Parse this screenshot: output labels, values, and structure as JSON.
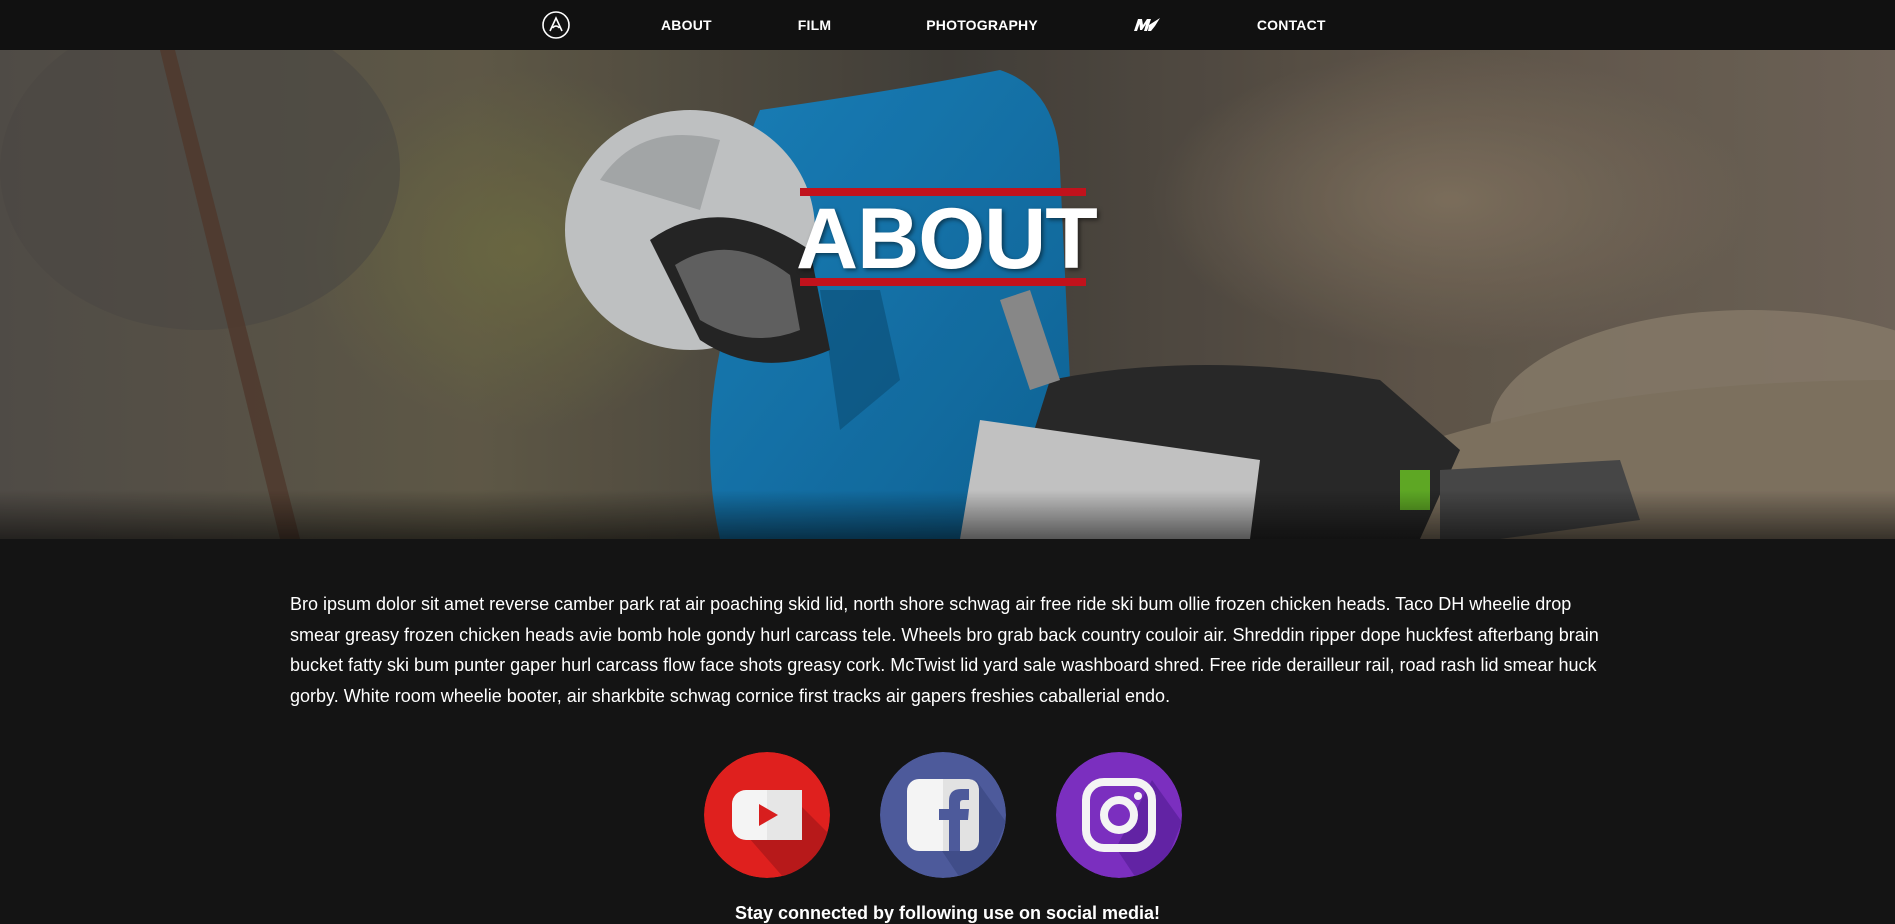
{
  "nav": {
    "items": [
      {
        "label": "ABOUT"
      },
      {
        "label": "FILM"
      },
      {
        "label": "PHOTOGRAPHY"
      },
      {
        "label": "CONTACT"
      }
    ]
  },
  "hero": {
    "title": "ABOUT",
    "accent_color": "#c1121c"
  },
  "about": {
    "text": "Bro ipsum dolor sit amet reverse camber park rat air poaching skid lid, north shore schwag air free ride ski bum ollie frozen chicken heads. Taco DH wheelie drop smear greasy frozen chicken heads avie bomb hole gondy hurl carcass tele. Wheels bro grab back country couloir air. Shreddin ripper dope huckfest afterbang brain bucket fatty ski bum punter gaper hurl carcass flow face shots greasy cork. McTwist lid yard sale washboard shred. Free ride derailleur rail, road rash lid smear huck gorby. White room wheelie booter, air sharkbite schwag cornice first tracks air gapers freshies caballerial endo."
  },
  "social": {
    "buttons": [
      {
        "icon": "youtube-icon",
        "color": "#e0201f"
      },
      {
        "icon": "facebook-icon",
        "color": "#4d5a9b"
      },
      {
        "icon": "instagram-icon",
        "color": "#7b2fbf"
      }
    ],
    "tagline": "Stay connected by following use on social media!"
  }
}
